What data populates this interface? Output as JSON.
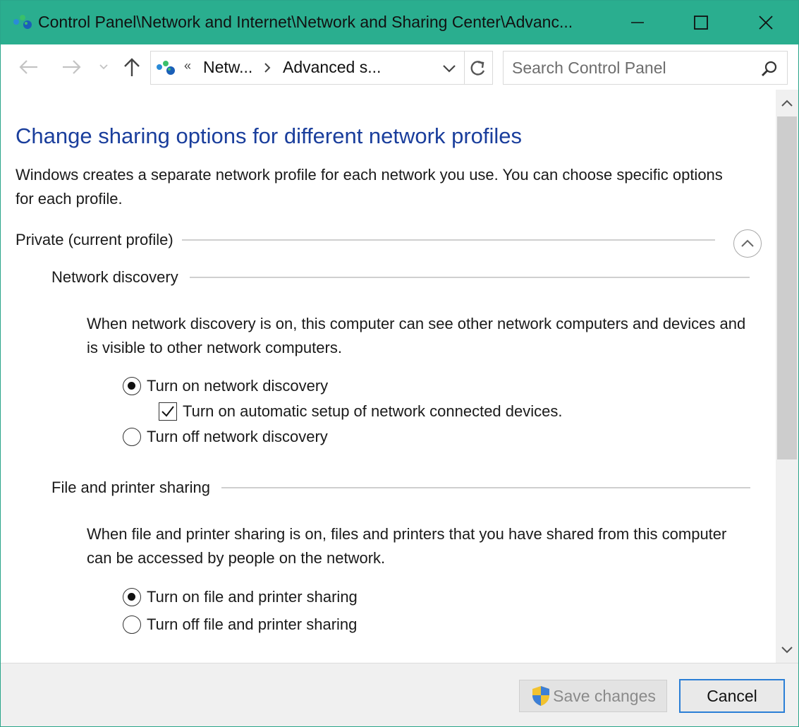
{
  "window": {
    "title": "Control Panel\\Network and Internet\\Network and Sharing Center\\Advanc...",
    "accent_color": "#2aae8f",
    "icons": [
      "network-icon",
      "minimize-icon",
      "maximize-icon",
      "close-icon"
    ]
  },
  "navigation": {
    "breadcrumb_overflow": "«",
    "breadcrumb": [
      "Netw...",
      "Advanced s..."
    ],
    "icons": [
      "back-arrow-icon",
      "forward-arrow-icon",
      "recent-chevron-icon",
      "up-arrow-icon",
      "chevron-right-icon",
      "chevron-down-icon",
      "refresh-icon"
    ]
  },
  "search": {
    "placeholder": "Search Control Panel",
    "icon": "search-icon"
  },
  "content": {
    "heading": "Change sharing options for different network profiles",
    "heading_color": "#1a3e9c",
    "intro": "Windows creates a separate network profile for each network you use. You can choose specific options for each profile.",
    "profile": {
      "label": "Private (current profile)",
      "collapse_icon": "chevron-up-circle-icon"
    },
    "network_discovery": {
      "title": "Network discovery",
      "description": "When network discovery is on, this computer can see other network computers and devices and is visible to other network computers.",
      "options": [
        {
          "label": "Turn on network discovery",
          "selected": true
        },
        {
          "label": "Turn off network discovery",
          "selected": false
        }
      ],
      "auto_setup": {
        "label": "Turn on automatic setup of network connected devices.",
        "checked": true
      }
    },
    "file_printer_sharing": {
      "title": "File and printer sharing",
      "description": "When file and printer sharing is on, files and printers that you have shared from this computer can be accessed by people on the network.",
      "options": [
        {
          "label": "Turn on file and printer sharing",
          "selected": true
        },
        {
          "label": "Turn off file and printer sharing",
          "selected": false
        }
      ]
    }
  },
  "footer": {
    "save_label": "Save changes",
    "save_icon": "uac-shield-icon",
    "cancel_label": "Cancel"
  }
}
